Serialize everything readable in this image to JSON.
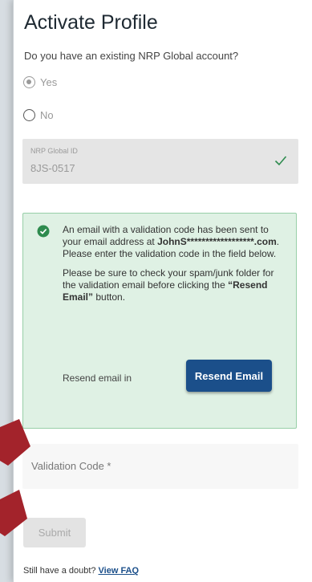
{
  "page": {
    "title": "Activate Profile",
    "question": "Do you have an existing NRP Global account?"
  },
  "radios": [
    {
      "label": "Yes",
      "checked": true
    },
    {
      "label": "No",
      "checked": false
    }
  ],
  "id_field": {
    "label": "NRP Global ID",
    "value": "8JS-0517",
    "status_icon": "check-icon"
  },
  "alert": {
    "icon": "check-circle-icon",
    "line1_pre": "An email with a validation code has been sent to your email address at ",
    "masked_email": "JohnS******************.com",
    "line1_post": ". Please enter the validation code in the field below.",
    "line2_pre": "Please be sure to check your spam/junk folder for the validation email before clicking the ",
    "line2_bold": "“Resend Email”",
    "line2_post": " button.",
    "resend_label": "Resend email in",
    "resend_button": "Resend Email",
    "colors": {
      "background": "#dff1e4",
      "border": "#97cfa7",
      "icon": "#2e8b4e"
    }
  },
  "validation": {
    "label": "Validation Code *"
  },
  "submit_button": "Submit",
  "footer": {
    "text": "Still have a doubt?",
    "link": "View FAQ"
  },
  "colors": {
    "brand": "#1b4f8a",
    "marker": "#a3232b"
  }
}
